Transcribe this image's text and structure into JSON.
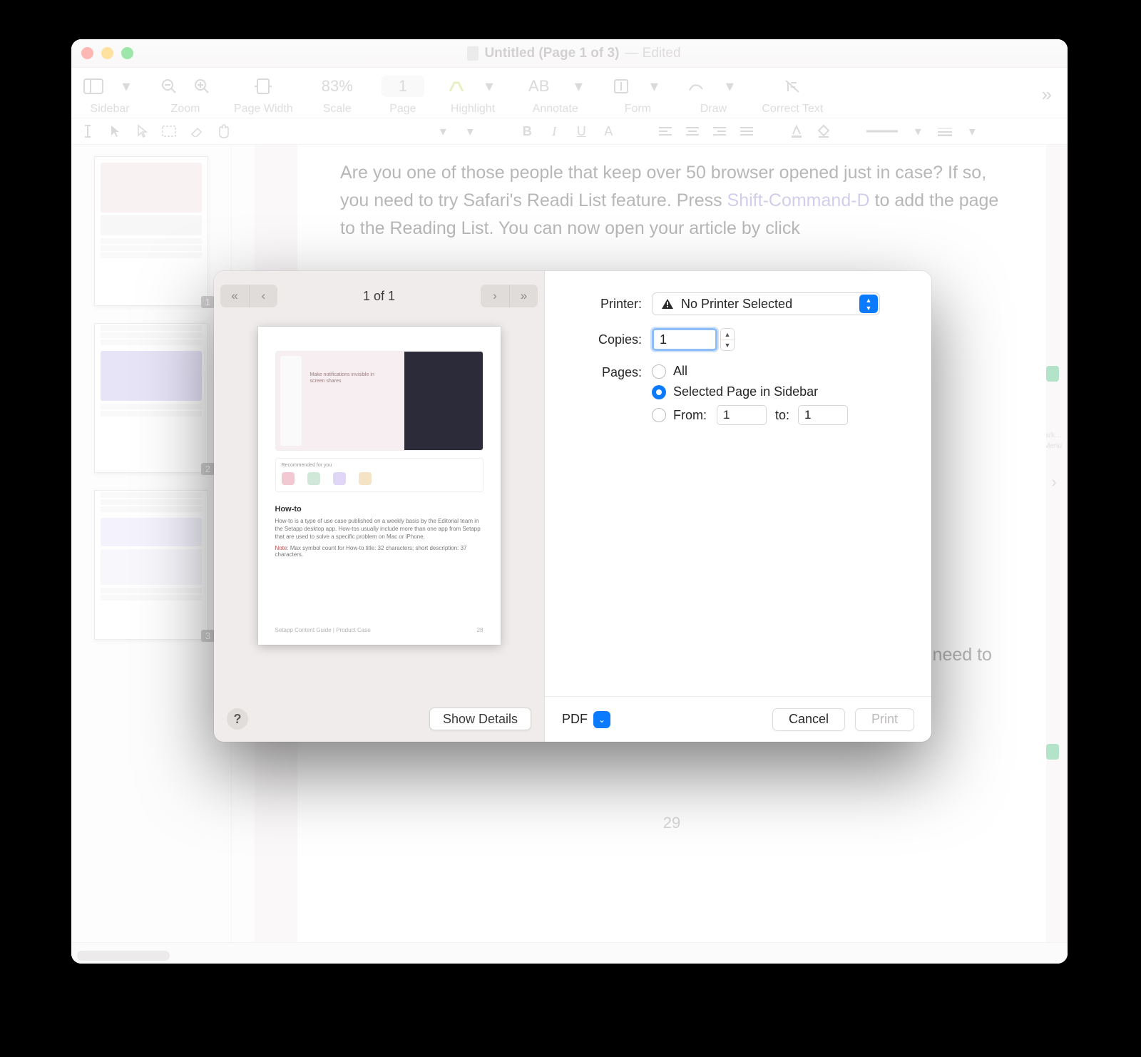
{
  "window": {
    "title_main": "Untitled (Page 1 of 3)",
    "title_suffix": "— Edited"
  },
  "toolbar": {
    "sidebar_label": "Sidebar",
    "zoom_label": "Zoom",
    "pagewidth_label": "Page Width",
    "scale_value": "83%",
    "scale_label": "Scale",
    "page_value": "1",
    "page_label": "Page",
    "highlight_label": "Highlight",
    "annotate_label": "Annotate",
    "form_label": "Form",
    "draw_label": "Draw",
    "correct_label": "Correct Text"
  },
  "sidebar": {
    "pages": [
      "1",
      "2",
      "3"
    ]
  },
  "rightside": {
    "line1": "Bookmark…",
    "line2": "Menu"
  },
  "document": {
    "paragraph_pre": "Are you one of those people that keep over 50 browser opened just in case? If so, you need to try Safari's Readi  List feature. Press ",
    "shortcut": "Shift-Command-D",
    "paragraph_post": " to add the page to the Reading List. You can now open your article by click",
    "para2": "choose Save Offline. Now you can read your articles anywhere without the need to connect to the internet.",
    "page_num": "29"
  },
  "print": {
    "nav_indicator": "1 of 1",
    "preview": {
      "hero_caption": "Make notifications invisible in screen shares",
      "rec_title": "Recommended for you",
      "howto_title": "How-to",
      "howto_body": "How-to is a type of use case published on a weekly basis by the Editorial team in the Setapp desktop app. How-tos usually include more than one app from Setapp that are used to solve a specific problem on Mac or iPhone.",
      "howto_note_label": "Note:",
      "howto_note_text": " Max symbol count for How-to title: 32 characters; short description: 37 characters.",
      "footer_left": "Setapp Content Guide | Product Case",
      "footer_right": "28"
    },
    "printer_label": "Printer:",
    "printer_value": "No Printer Selected",
    "copies_label": "Copies:",
    "copies_value": "1",
    "pages_label": "Pages:",
    "pages_all": "All",
    "pages_selected": "Selected Page in Sidebar",
    "pages_from": "From:",
    "pages_from_value": "1",
    "pages_to": "to:",
    "pages_to_value": "1",
    "show_details": "Show Details",
    "pdf_label": "PDF",
    "cancel": "Cancel",
    "print_btn": "Print"
  }
}
